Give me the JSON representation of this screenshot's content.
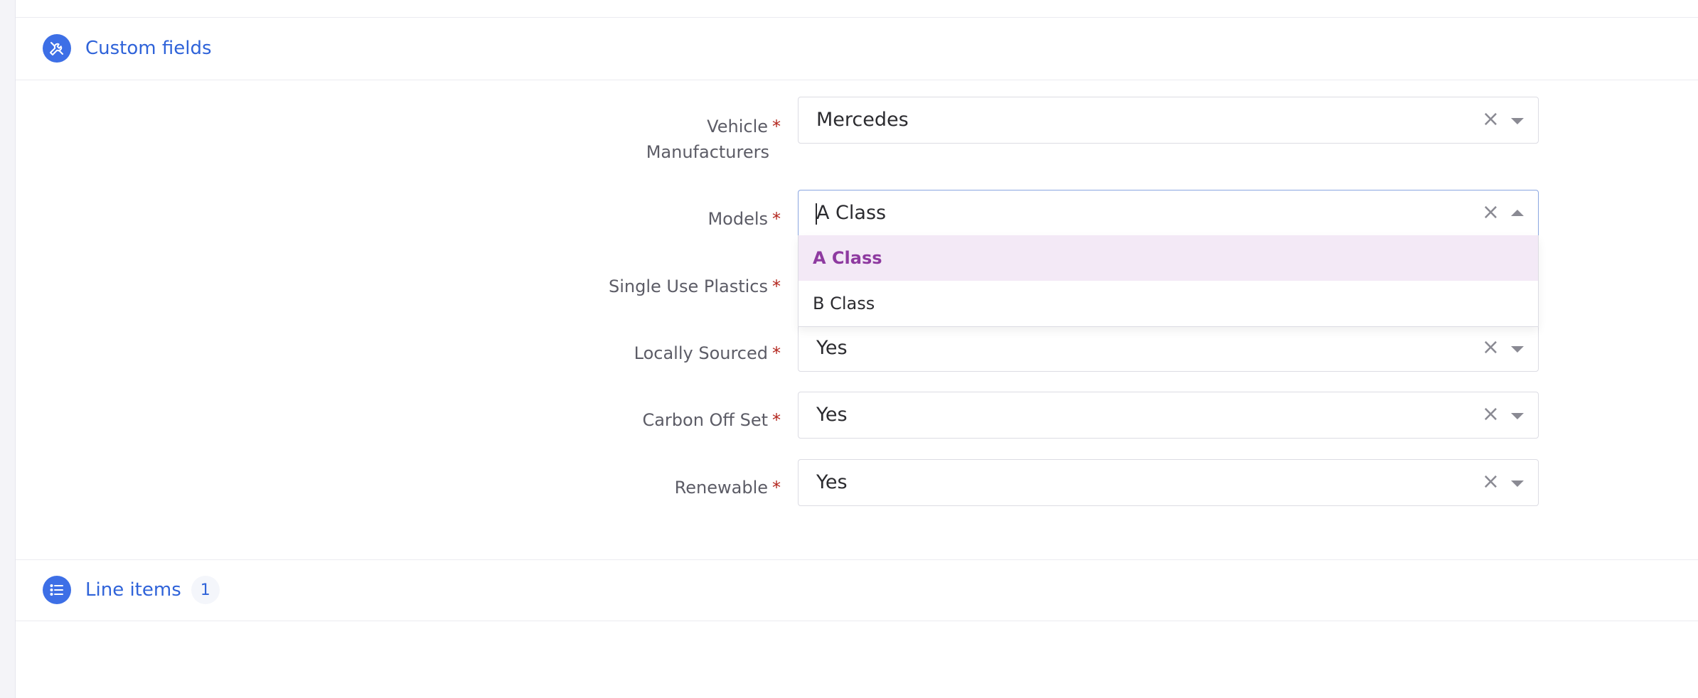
{
  "sections": {
    "custom_fields": {
      "title": "Custom fields",
      "icon": "tools-icon"
    },
    "line_items": {
      "title": "Line items",
      "count": "1",
      "icon": "list-icon"
    }
  },
  "fields": [
    {
      "label_line1": "Vehicle",
      "label_line2": "Manufacturers",
      "required": "*",
      "value": "Mercedes"
    },
    {
      "label": "Models",
      "required": "*",
      "value": "A Class",
      "open": true
    },
    {
      "label": "Single Use Plastics",
      "required": "*",
      "value": ""
    },
    {
      "label": "Locally Sourced",
      "required": "*",
      "value": "Yes"
    },
    {
      "label": "Carbon Off Set",
      "required": "*",
      "value": "Yes"
    },
    {
      "label": "Renewable",
      "required": "*",
      "value": "Yes"
    }
  ],
  "models_dropdown": {
    "options": [
      "A Class",
      "B Class"
    ],
    "selected": "A Class"
  },
  "clear_symbol": "×",
  "colors": {
    "accent": "#2f63d9",
    "icon_bg": "#3d6fe6",
    "required": "#b3261e",
    "selected_option_bg": "#f3e9f6",
    "selected_option_text": "#8e3aa0"
  }
}
